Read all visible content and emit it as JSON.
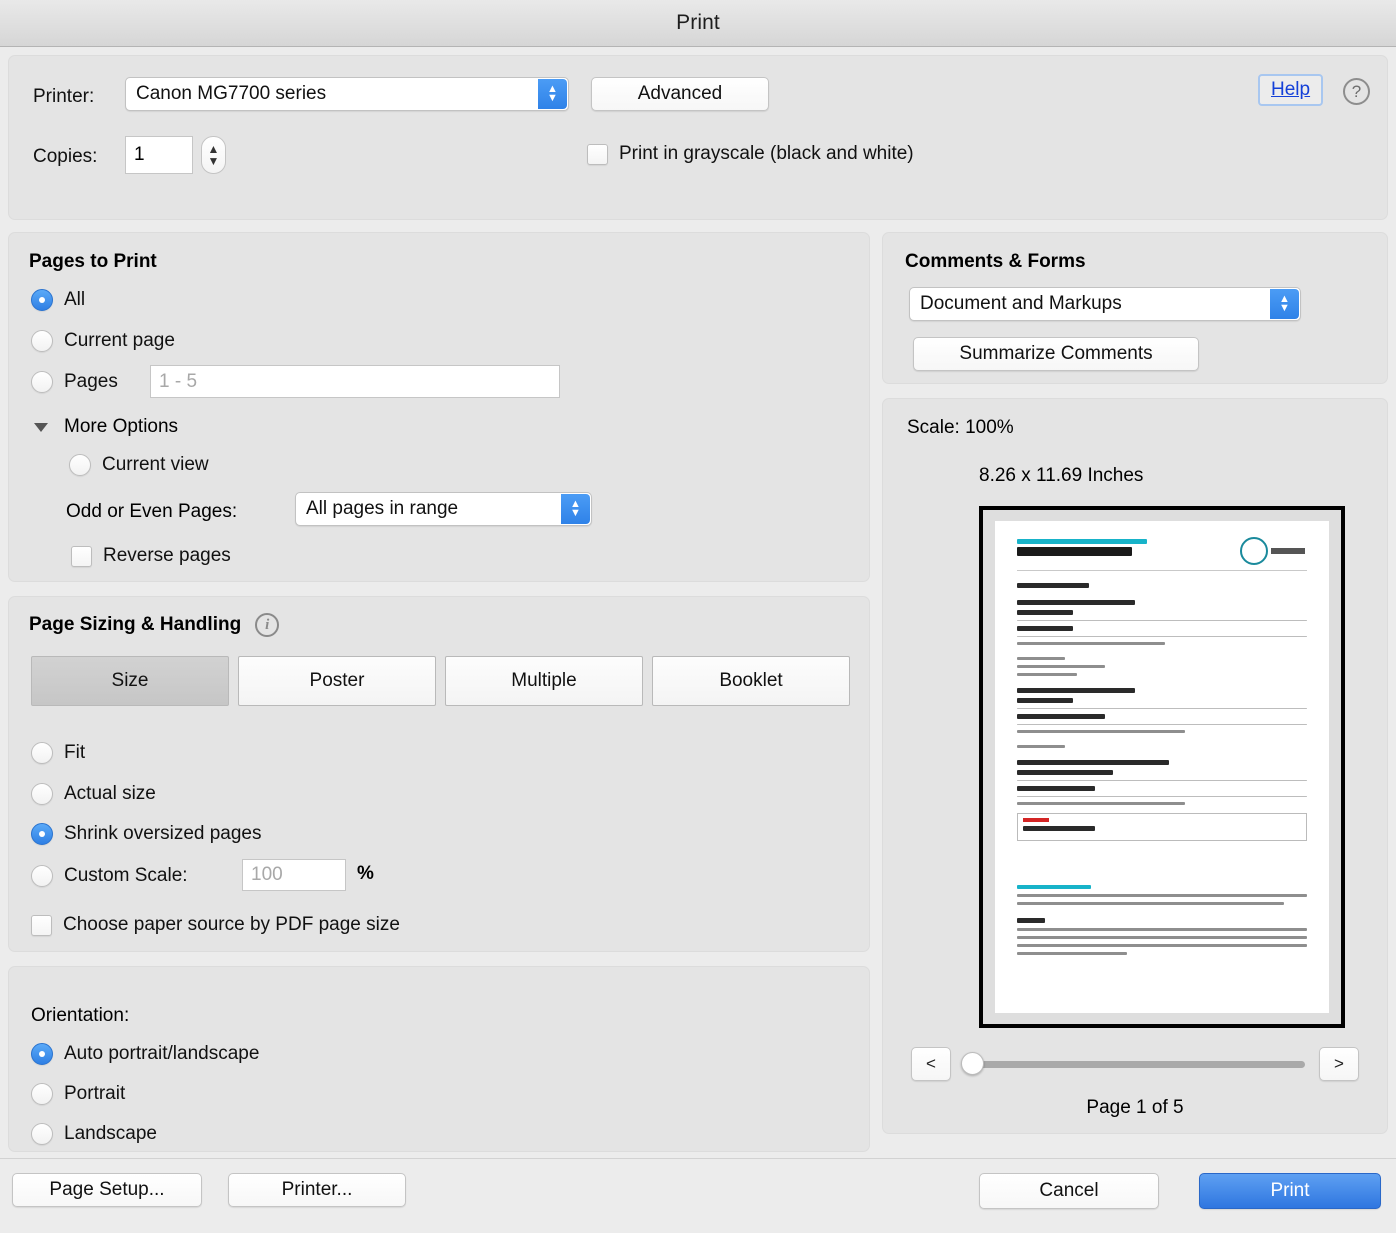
{
  "window": {
    "title": "Print"
  },
  "top": {
    "printer_label": "Printer:",
    "printer_value": "Canon MG7700 series",
    "advanced_label": "Advanced",
    "copies_label": "Copies:",
    "copies_value": "1",
    "grayscale_label": "Print in grayscale (black and white)",
    "grayscale_checked": false,
    "help_label": "Help",
    "help_icon": "question-mark-icon",
    "stepper_up": "▲",
    "stepper_down": "▼"
  },
  "pages_to_print": {
    "title": "Pages to Print",
    "options": [
      {
        "label": "All",
        "selected": true
      },
      {
        "label": "Current page",
        "selected": false
      },
      {
        "label": "Pages",
        "selected": false
      }
    ],
    "pages_placeholder": "1 - 5",
    "pages_value": "",
    "more_options_label": "More Options",
    "more_options_expanded": true,
    "current_view": {
      "label": "Current view",
      "selected": false
    },
    "odd_even_label": "Odd or Even Pages:",
    "odd_even_value": "All pages in range",
    "reverse_label": "Reverse pages",
    "reverse_checked": false
  },
  "page_sizing": {
    "title": "Page Sizing & Handling",
    "info_icon": "info-icon",
    "tabs": [
      {
        "label": "Size",
        "selected": true
      },
      {
        "label": "Poster",
        "selected": false
      },
      {
        "label": "Multiple",
        "selected": false
      },
      {
        "label": "Booklet",
        "selected": false
      }
    ],
    "options": [
      {
        "label": "Fit",
        "selected": false
      },
      {
        "label": "Actual size",
        "selected": false
      },
      {
        "label": "Shrink oversized pages",
        "selected": true
      },
      {
        "label": "Custom Scale:",
        "selected": false
      }
    ],
    "custom_scale_placeholder": "100",
    "custom_scale_value": "",
    "percent_symbol": "%",
    "paper_source_label": "Choose paper source by PDF page size",
    "paper_source_checked": false
  },
  "orientation": {
    "title": "Orientation:",
    "options": [
      {
        "label": "Auto portrait/landscape",
        "selected": true
      },
      {
        "label": "Portrait",
        "selected": false
      },
      {
        "label": "Landscape",
        "selected": false
      }
    ]
  },
  "comments_forms": {
    "title": "Comments & Forms",
    "selected": "Document and Markups",
    "summarize_label": "Summarize Comments"
  },
  "preview": {
    "scale_label": "Scale: 100%",
    "dimensions": "8.26 x 11.69 Inches",
    "page_indicator": "Page 1 of 5",
    "prev_label": "<",
    "next_label": ">",
    "slider_position": 0,
    "document": {
      "kicker_color": "#17b3c9",
      "brand": "KIWI.COM",
      "route": "Bristol – Guangzhou"
    }
  },
  "footer": {
    "page_setup_label": "Page Setup...",
    "printer_label": "Printer...",
    "cancel_label": "Cancel",
    "print_label": "Print"
  }
}
